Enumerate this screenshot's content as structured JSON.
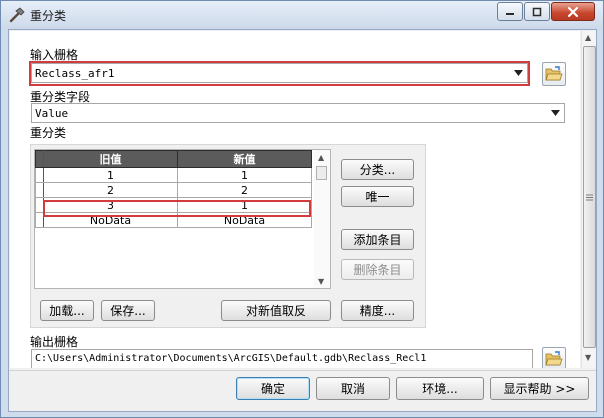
{
  "window": {
    "title": "重分类"
  },
  "input_raster": {
    "label": "输入栅格",
    "value": "Reclass_afr1"
  },
  "reclass_field": {
    "label": "重分类字段",
    "value": "Value"
  },
  "reclass": {
    "label": "重分类",
    "columns": [
      "旧值",
      "新值"
    ],
    "rows": [
      {
        "old": "1",
        "new": "1"
      },
      {
        "old": "2",
        "new": "2"
      },
      {
        "old": "3",
        "new": "1"
      },
      {
        "old": "NoData",
        "new": "NoData"
      }
    ],
    "buttons": {
      "classify": "分类...",
      "unique": "唯一",
      "add_entry": "添加条目",
      "delete_entry": "删除条目",
      "load": "加载...",
      "save": "保存...",
      "reverse": "对新值取反",
      "precision": "精度..."
    }
  },
  "output_raster": {
    "label": "输出栅格",
    "value": "C:\\Users\\Administrator\\Documents\\ArcGIS\\Default.gdb\\Reclass_Recl1"
  },
  "footer": {
    "ok": "确定",
    "cancel": "取消",
    "environments": "环境...",
    "show_help": "显示帮助 >>"
  },
  "colors": {
    "highlight": "#d33c3c",
    "header": "#5b5b5b"
  }
}
